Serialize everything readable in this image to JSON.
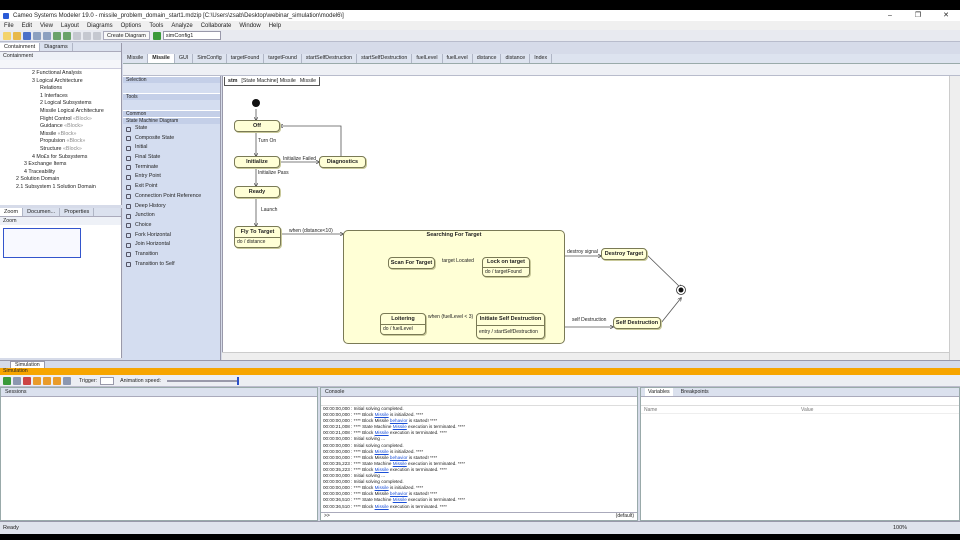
{
  "window": {
    "title": "Cameo Systems Modeler 19.0 - missile_problem_domain_start1.mdzip [C:\\Users\\zsab\\Desktop\\webinar_simulation\\model6\\]"
  },
  "menu": [
    "File",
    "Edit",
    "View",
    "Layout",
    "Diagrams",
    "Options",
    "Tools",
    "Analyze",
    "Collaborate",
    "Window",
    "Help"
  ],
  "toolbar": {
    "create_diagram": "Create Diagram",
    "config": "simConfig1"
  },
  "left_tabs": [
    "Containment",
    "Diagrams"
  ],
  "containment_label": "Containment",
  "tree": [
    {
      "text": "2 Functional Analysis",
      "indent": 30
    },
    {
      "text": "3 Logical Architecture",
      "indent": 30
    },
    {
      "text": "Relations",
      "indent": 38
    },
    {
      "text": "1 Interfaces",
      "indent": 38
    },
    {
      "text": "2 Logical Subsystems",
      "indent": 38
    },
    {
      "text": "Missile Logical Architecture",
      "indent": 38
    },
    {
      "text": "Flight Control",
      "suffix": " «Block»",
      "indent": 38
    },
    {
      "text": "Guidance",
      "suffix": " «Block»",
      "indent": 38
    },
    {
      "text": "Missile",
      "suffix": " «Block»",
      "indent": 38
    },
    {
      "text": "Propulsion",
      "suffix": " «Block»",
      "indent": 38
    },
    {
      "text": "Structure",
      "suffix": " «Block»",
      "indent": 38
    },
    {
      "text": "4 Mo£s for Subsystems",
      "indent": 30
    },
    {
      "text": "3 Exchange Items",
      "indent": 22
    },
    {
      "text": "4 Traceability",
      "indent": 22
    },
    {
      "text": "2 Solution Domain",
      "indent": 14
    },
    {
      "text": "2.1 Subsystem 1 Solution Domain",
      "indent": 14
    }
  ],
  "lower_left_tabs": [
    "Zoom",
    "Documen...",
    "Properties"
  ],
  "zoom_label": "Zoom",
  "editor_tabs": [
    "Missile",
    "Missile",
    "GUI",
    "SimConfig",
    "targetFound",
    "targetFound",
    "startSelfDestruction",
    "startSelfDestruction",
    "fuelLevel",
    "fuelLevel",
    "distance",
    "distance",
    "Index"
  ],
  "diagram_header": [
    "stm",
    "[State Machine] Missile",
    "Missile"
  ],
  "palette": {
    "selection": "Selection",
    "tools": "Tools",
    "common": "Common",
    "sm_diagram": "State Machine Diagram",
    "items": [
      "State",
      "Composite State",
      "Initial",
      "Final State",
      "Terminate",
      "Entry Point",
      "Exit Point",
      "Connection Point Reference",
      "Deep History",
      "Junction",
      "Choice",
      "Fork Horizontal",
      "Join Horizontal",
      "Transition",
      "Transition to Self"
    ]
  },
  "states": {
    "off": "Off",
    "initialize": "Initialize",
    "diagnostics": "Diagnostics",
    "ready": "Ready",
    "fly": "Fly To Target",
    "fly_do": "do / distance",
    "searching": "Searching For Target",
    "scan": "Scan For Target",
    "lock": "Lock on target",
    "lock_do": "do / targetFound",
    "loiter": "Loitering",
    "loiter_do": "do / fuelLevel",
    "init_sd": "Initiate Self Destruction",
    "init_sd_entry": "entry / startSelfDestruction",
    "destroy": "Destroy Target",
    "self_destruction": "Self Destruction"
  },
  "transitions": {
    "turn_on": "Turn On",
    "init_failed": "Initialize Failed",
    "init_pass": "Initialize Pass",
    "launch": "Launch",
    "when_dist": "when (distance<10)",
    "target_located": "target Located",
    "fuel": "when (fuelLevel < 3)",
    "destroy_signal": "destroy signal",
    "self_destruction": "self Destruction"
  },
  "simulation": {
    "tab": "Simulation",
    "header": "Simulation",
    "trigger": "Trigger:",
    "anim_speed": "Animation speed:",
    "sessions": "Sessions",
    "console": "Console",
    "variables": "Variables",
    "breakpoints": "Breakpoints",
    "col_name": "Name",
    "col_value": "Value",
    "console_input": ">>",
    "console_mode": "(default)"
  },
  "console_lines": [
    [
      "00:00:00,000 : Initial solving completed.",
      "",
      ""
    ],
    [
      "00:00:00,000 : **** Block ",
      "Missile",
      " is initialized. ****"
    ],
    [
      "00:00:00,000 : **** Block Missile ",
      "behavior",
      " is started! ****"
    ],
    [
      "00:00:21,008 : **** State Machine ",
      "Missile",
      " execution is terminated. ****"
    ],
    [
      "00:00:21,008 : **** Block ",
      "Missile",
      " execution is terminated. ****"
    ],
    [
      "00:00:00,000 : Initial solving ...",
      "",
      ""
    ],
    [
      "00:00:00,000 : Initial solving completed.",
      "",
      ""
    ],
    [
      "00:00:00,000 : **** Block ",
      "Missile",
      " is initialized. ****"
    ],
    [
      "00:00:00,000 : **** Block Missile ",
      "behavior",
      " is started! ****"
    ],
    [
      "00:00:35,223 : **** State Machine ",
      "Missile",
      " execution is terminated. ****"
    ],
    [
      "00:00:35,223 : **** Block ",
      "Missile",
      " execution is terminated. ****"
    ],
    [
      "00:00:00,000 : Initial solving ...",
      "",
      ""
    ],
    [
      "00:00:00,000 : Initial solving completed.",
      "",
      ""
    ],
    [
      "00:00:00,000 : **** Block ",
      "Missile",
      " is initialized. ****"
    ],
    [
      "00:00:00,000 : **** Block Missile ",
      "behavior",
      " is started! ****"
    ],
    [
      "00:00:36,510 : **** State Machine ",
      "Missile",
      " execution is terminated. ****"
    ],
    [
      "00:00:36,510 : **** Block ",
      "Missile",
      " execution is terminated. ****"
    ]
  ],
  "status": {
    "text": "Ready",
    "zoom": "100%"
  }
}
